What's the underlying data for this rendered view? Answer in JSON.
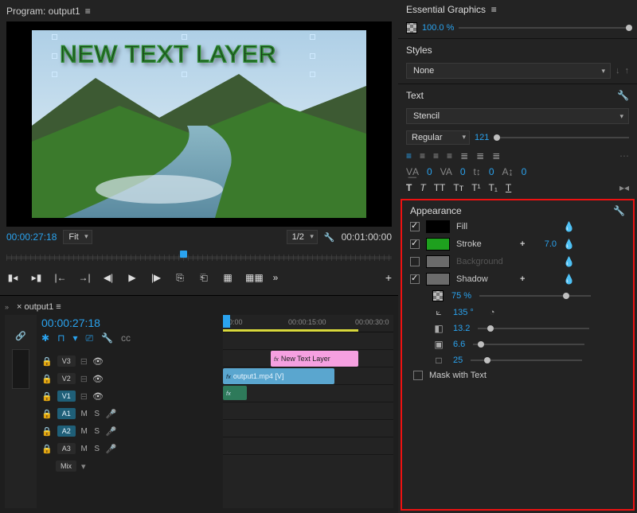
{
  "program": {
    "title": "Program: output1",
    "overlay_text": "NEW TEXT LAYER",
    "current_tc": "00:00:27:18",
    "fit_label": "Fit",
    "scale_label": "1/2",
    "duration_tc": "00:01:00:00"
  },
  "timeline": {
    "tab": "output1",
    "playhead_tc": "00:00:27:18",
    "ruler": {
      "t0": "00:00",
      "t1": "00:00:15:00",
      "t2": "00:00:30:0"
    },
    "tracks": {
      "v3": "V3",
      "v2": "V2",
      "v1": "V1",
      "a1": "A1",
      "a2": "A2",
      "a3": "A3",
      "mix": "Mix"
    },
    "clips": {
      "text_layer": "New Text Layer",
      "video": "output1.mp4 [V]",
      "fx": "fx"
    },
    "m": "M",
    "s": "S"
  },
  "essential": {
    "title": "Essential Graphics",
    "opacity": "100.0 %",
    "styles_header": "Styles",
    "styles_value": "None",
    "text_header": "Text",
    "font": "Stencil",
    "weight": "Regular",
    "size": "121",
    "kern1": "0",
    "kern2": "0",
    "kern3": "0",
    "kern4": "0"
  },
  "appearance": {
    "header": "Appearance",
    "fill_label": "Fill",
    "stroke_label": "Stroke",
    "stroke_value": "7.0",
    "bg_label": "Background",
    "shadow_label": "Shadow",
    "shadow_opacity": "75 %",
    "shadow_angle": "135 °",
    "shadow_distance": "13.2",
    "shadow_spread": "6.6",
    "shadow_blur": "25",
    "mask_label": "Mask with Text",
    "colors": {
      "fill": "#000000",
      "stroke": "#1ea01e",
      "bg": "#6b6b6b",
      "shadow": "#6b6b6b"
    }
  }
}
